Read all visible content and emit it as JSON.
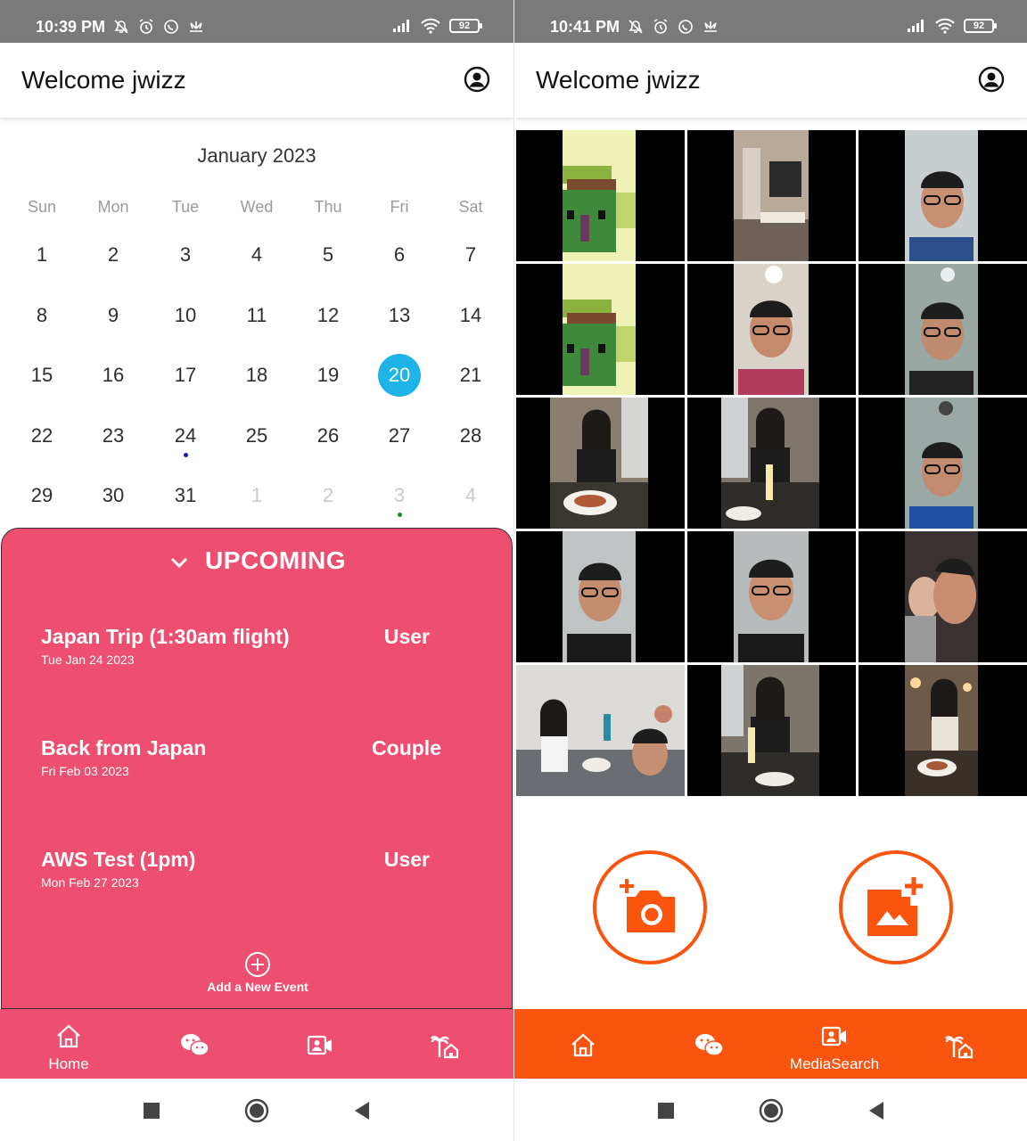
{
  "colors": {
    "status_bar": "#7a7a7a",
    "accent_blue": "#1eb4e8",
    "upcoming_panel": "#ee4f70",
    "nav_pink": "#ee4f70",
    "nav_orange": "#fa540f"
  },
  "left": {
    "status": {
      "time": "10:39 PM",
      "battery": "92"
    },
    "app_bar": {
      "title": "Welcome jwizz",
      "profile_icon": "account-circle-icon"
    },
    "calendar": {
      "month": "January 2023",
      "weekdays": [
        "Sun",
        "Mon",
        "Tue",
        "Wed",
        "Thu",
        "Fri",
        "Sat"
      ],
      "days": [
        "1",
        "2",
        "3",
        "4",
        "5",
        "6",
        "7",
        "8",
        "9",
        "10",
        "11",
        "12",
        "13",
        "14",
        "15",
        "16",
        "17",
        "18",
        "19",
        "20",
        "21",
        "22",
        "23",
        "24",
        "25",
        "26",
        "27",
        "28",
        "29",
        "30",
        "31",
        "1",
        "2",
        "3",
        "4"
      ],
      "selected_day": "20",
      "event_dot_days": [
        "24",
        "3"
      ]
    },
    "upcoming": {
      "header": "UPCOMING",
      "events": [
        {
          "title": "Japan Trip (1:30am flight)",
          "date": "Tue Jan 24 2023",
          "tag": "User"
        },
        {
          "title": "Back from Japan",
          "date": "Fri Feb 03 2023",
          "tag": "Couple"
        },
        {
          "title": "AWS Test (1pm)",
          "date": "Mon Feb 27 2023",
          "tag": "User"
        }
      ],
      "add_label": "Add a New Event"
    },
    "nav": {
      "home_label": "Home",
      "active": "home"
    }
  },
  "right": {
    "status": {
      "time": "10:41 PM",
      "battery": "92"
    },
    "app_bar": {
      "title": "Welcome jwizz",
      "profile_icon": "account-circle-icon"
    },
    "media": {
      "tile_count": 15
    },
    "buttons": {
      "camera": "add-camera-icon",
      "gallery": "add-photo-icon"
    },
    "nav": {
      "media_label": "MediaSearch",
      "active": "media-search"
    }
  }
}
